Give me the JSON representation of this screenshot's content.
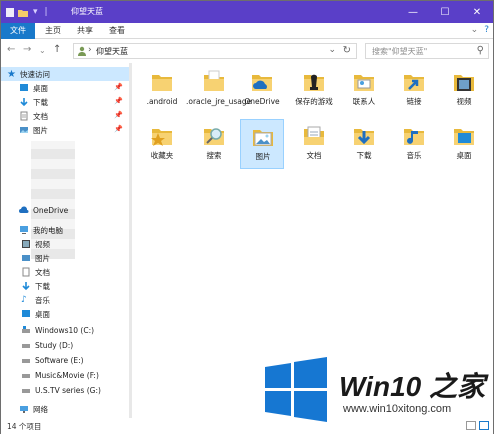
{
  "window": {
    "title": "仰望天蓝"
  },
  "ribbon": {
    "tabs": [
      "文件",
      "主页",
      "共享",
      "查看"
    ]
  },
  "address": {
    "path": "仰望天蓝"
  },
  "search": {
    "placeholder": "搜索\"仰望天蓝\""
  },
  "nav": {
    "quick_access": "快速访问",
    "pinned": [
      "桌面",
      "下载",
      "文档",
      "图片"
    ],
    "onedrive": "OneDrive",
    "this_pc": "我的电脑",
    "pc_items": [
      "视频",
      "图片",
      "文档",
      "下载",
      "音乐",
      "桌面",
      "Windows10 (C:)",
      "Study (D:)",
      "Software (E:)",
      "Music&Movie (F:)",
      "U.S.TV series  (G:)"
    ],
    "network": "网络"
  },
  "items": [
    ".android",
    ".oracle_jre_usage",
    "OneDrive",
    "保存的游戏",
    "联系人",
    "链接",
    "视频",
    "收藏夹",
    "搜索",
    "图片",
    "文档",
    "下载",
    "音乐",
    "桌面"
  ],
  "status": {
    "count": "14 个项目"
  },
  "watermark": {
    "brand": "Win10 之家",
    "url": "www.win10xitong.com"
  },
  "colors": {
    "titlebar": "#5a3fc8",
    "file_tab": "#1979ca",
    "selection": "#cce8ff",
    "folder": "#f7c85a"
  }
}
